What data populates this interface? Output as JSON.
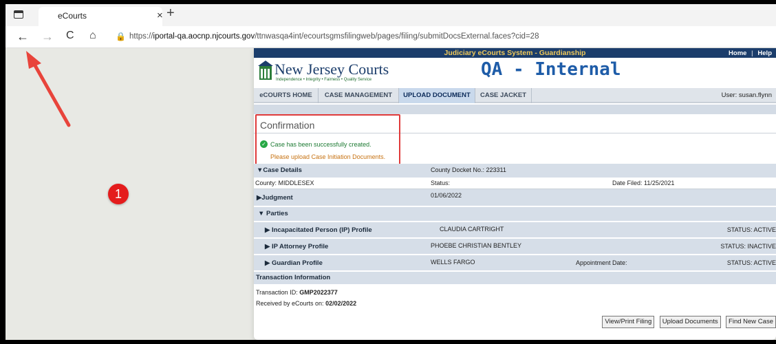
{
  "browser": {
    "tab_title": "eCourts",
    "tab_close": "×",
    "new_tab": "+",
    "back": "←",
    "forward": "→",
    "reload": "C",
    "home": "⌂",
    "url_prefix": "https://",
    "url_host": "iportal-qa.aocnp.njcourts.gov",
    "url_path": "/ttnwasqa4int/ecourtsgmsfilingweb/pages/filing/submitDocsExternal.faces?cid=28"
  },
  "annotation": {
    "badge": "1"
  },
  "header": {
    "system_title": "Judiciary eCourts System - Guardianship",
    "home_link": "Home",
    "separator": "|",
    "help_link": "Help",
    "logo_text": "New Jersey Courts",
    "logo_tagline": "Independence • Integrity • Fairness • Quality Service",
    "environment": "QA - Internal",
    "user": "User: susan.flynn"
  },
  "menu": [
    {
      "label": "eCOURTS HOME"
    },
    {
      "label": "CASE MANAGEMENT"
    },
    {
      "label": "UPLOAD DOCUMENT"
    },
    {
      "label": "CASE JACKET"
    }
  ],
  "confirmation": {
    "title": "Confirmation",
    "success": "Case has been successfully created.",
    "instruction": "Please upload Case Initiation Documents."
  },
  "case_details": {
    "header": "▼Case Details",
    "docket": "County Docket No.: 223311",
    "county": "County: MIDDLESEX",
    "status": "Status:",
    "date_filed": "Date Filed: 11/25/2021"
  },
  "judgment": {
    "label": "▶Judgment",
    "date": "01/06/2022"
  },
  "parties": {
    "header": "▼  Parties",
    "rows": [
      {
        "label": "▶ Incapacitated Person (IP) Profile",
        "name": "CLAUDIA CARTRIGHT",
        "extra": "",
        "status": "STATUS: ACTIVE"
      },
      {
        "label": "▶ IP Attorney Profile",
        "name": "PHOEBE CHRISTIAN BENTLEY",
        "extra": "",
        "status": "STATUS: INACTIVE"
      },
      {
        "label": "▶ Guardian Profile",
        "name": "WELLS FARGO",
        "extra": "Appointment Date:",
        "status": "STATUS: ACTIVE"
      }
    ]
  },
  "transaction": {
    "header": "Transaction Information",
    "id_label": "Transaction ID:",
    "id_value": "GMP2022377",
    "received_label": "Received by eCourts on:",
    "received_value": "02/02/2022"
  },
  "buttons": {
    "view_print": "View/Print Filing",
    "upload": "Upload Documents",
    "find_new": "Find New Case"
  },
  "colors": {
    "header_bar": "#1b3d6b",
    "accent": "#1e5ca8",
    "success": "#1c7a32",
    "warning": "#c77212",
    "highlight": "#e03a3a"
  }
}
